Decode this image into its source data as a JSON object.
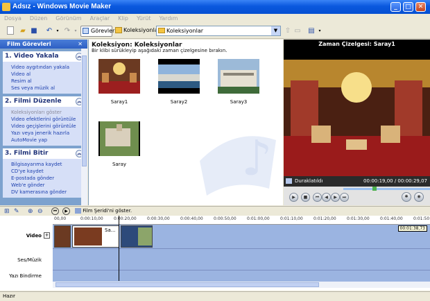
{
  "window": {
    "title": "Adsız - Windows Movie Maker"
  },
  "menu": [
    "Dosya",
    "Düzen",
    "Görünüm",
    "Araçlar",
    "Klip",
    "Yürüt",
    "Yardım"
  ],
  "toolbar": {
    "tasks_label": "Görevler",
    "collections_label": "Koleksiyonlar",
    "collection_select": "Koleksiyonlar"
  },
  "tasks": {
    "header": "Film Görevleri",
    "sections": [
      {
        "title": "1. Video Yakala",
        "items": [
          "Video aygıtından yakala",
          "Video al",
          "Resim al",
          "Ses veya müzik al"
        ]
      },
      {
        "title": "2. Filmi Düzenle",
        "items": [
          "Koleksiyonları göster",
          "Video efektlerini görüntüle",
          "Video geçişlerini görüntüle",
          "Yazı veya jenerik hazırla",
          "AutoMovie yap"
        ]
      },
      {
        "title": "3. Filmi Bitir",
        "items": [
          "Bilgisayarıma kaydet",
          "CD'ye kaydet",
          "E-postada gönder",
          "Web'e gönder",
          "DV kamerasına gönder"
        ]
      }
    ]
  },
  "collection": {
    "title": "Koleksiyon: Koleksiyonlar",
    "subtitle": "Bir klibi sürükleyip aşağıdaki zaman çizelgesine bırakın.",
    "clips": [
      "Saray1",
      "Saray2",
      "Saray3",
      "Saray"
    ]
  },
  "preview": {
    "title": "Zaman Çizelgesi: Saray1",
    "status": "Duraklatıldı",
    "time": "00:00:19,00 / 00:00:29,07"
  },
  "storyboard": {
    "toggle_label": "Film Şeridi'ni göster."
  },
  "timeline": {
    "ticks": [
      "00,00",
      "0:00:10,00",
      "0:00:20,00",
      "0:00:30,00",
      "0:00:40,00",
      "0:00:50,00",
      "0:01:00,00",
      "0:01:10,00",
      "0:01:20,00",
      "0:01:30,00",
      "0:01:40,00",
      "0:01:50"
    ],
    "rows": [
      "Video",
      "Ses/Müzik",
      "Yazı Bindirme"
    ],
    "clip_label": "Sa...",
    "timestamp": "00:01:38,73"
  },
  "status": "Hazır",
  "colors": {
    "accent": "#0a58de",
    "task_bg": "#7da2ce",
    "timeline_bg": "#9bb4e1"
  }
}
